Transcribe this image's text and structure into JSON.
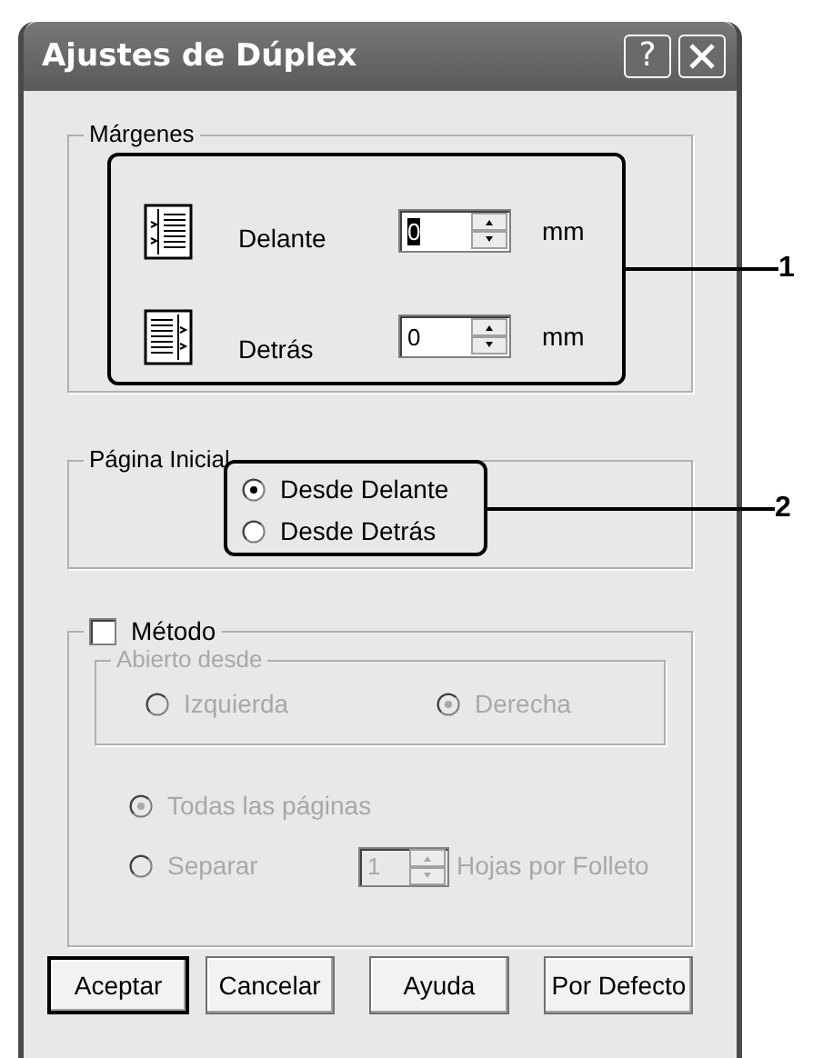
{
  "window": {
    "title": "Ajustes de Dúplex",
    "help_button": "?"
  },
  "margins": {
    "legend": "Márgenes",
    "callout": "1",
    "rows": [
      {
        "kind": "front",
        "label": "Delante",
        "value": "0",
        "focused": true,
        "unit": "mm"
      },
      {
        "kind": "back",
        "label": "Detrás",
        "value": "0",
        "focused": false,
        "unit": "mm"
      }
    ]
  },
  "start_page": {
    "legend": "Página Inicial",
    "callout": "2",
    "options": [
      {
        "label": "Desde Delante",
        "selected": true
      },
      {
        "label": "Desde Detrás",
        "selected": false
      }
    ]
  },
  "method": {
    "label": "Método",
    "checked": false,
    "disabled": true,
    "open_from": {
      "legend": "Abierto desde",
      "options": [
        {
          "label": "Izquierda",
          "selected": false
        },
        {
          "label": "Derecha",
          "selected": true
        }
      ]
    },
    "pages": [
      {
        "label": "Todas las páginas",
        "selected": true
      },
      {
        "label": "Separar",
        "selected": false
      }
    ],
    "sheets": {
      "value": "1",
      "label": "Hojas por Folleto"
    }
  },
  "buttons": [
    {
      "label": "Aceptar",
      "default": true
    },
    {
      "label": "Cancelar",
      "default": false
    },
    {
      "label": "Ayuda",
      "default": false
    },
    {
      "label": "Por Defecto",
      "default": false
    }
  ]
}
